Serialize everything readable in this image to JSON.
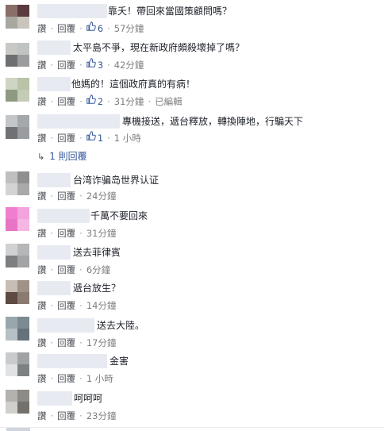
{
  "labels": {
    "like": "讚",
    "reply": "回覆",
    "dot": "·",
    "edited": "已編輯"
  },
  "comments": [
    {
      "text": "靠夭！帶回來當國策顧問嗎？",
      "likes": "6",
      "time": "57分鐘",
      "avatar": [
        "#8a6e6a",
        "#5c3b3f",
        "#a8a8a0",
        "#c9c4bc"
      ]
    },
    {
      "text": "太平島不爭，現在新政府頗殺壞掉了嗎？",
      "likes": "3",
      "time": "42分鐘",
      "avatar": [
        "#c8c8c4",
        "#bfc3c1",
        "#6d6f70",
        "#9a9c9d"
      ]
    },
    {
      "text": "他媽的！這個政府真的有病！",
      "likes": "2",
      "time": "31分鐘",
      "edited": true,
      "avatar": [
        "#cfd5c3",
        "#b8c3a8",
        "#8f9a82",
        "#c4ccb6"
      ]
    },
    {
      "text": "專機接送，遞台釋放，轉換陣地，行騙天下",
      "likes": "1",
      "time": "1 小時",
      "avatar": [
        "#c4c7c9",
        "#a4a8ab",
        "#6f7174",
        "#9a9da0"
      ]
    },
    {
      "text": "台湾诈骗岛世界认证",
      "time": "24分鐘",
      "avatar": [
        "#bfbfbf",
        "#8f8f8f",
        "#d3d3d3",
        "#a9a9a9"
      ]
    },
    {
      "text": "千萬不要回來",
      "time": "31分鐘",
      "avatar": [
        "#f07ed0",
        "#f3a3dd",
        "#e874c4",
        "#f6b6e3"
      ]
    },
    {
      "text": "送去菲律賓",
      "time": "6分鐘",
      "avatar": [
        "#cfd1d2",
        "#b5b7b8",
        "#7c7e80",
        "#a2a4a6"
      ]
    },
    {
      "text": "遞台放生？",
      "time": "14分鐘",
      "avatar": [
        "#c8bdb5",
        "#a09287",
        "#5e4a42",
        "#8a7b70"
      ]
    },
    {
      "text": "送去大陸。",
      "time": "17分鐘",
      "avatar": [
        "#9aa6ad",
        "#7b8a93",
        "#b7c0c5",
        "#65727a"
      ]
    },
    {
      "text": "金害",
      "time": "1 小時",
      "avatar": [
        "#c9cbcd",
        "#9fa3a6",
        "#e0e2e3",
        "#7d8184"
      ]
    },
    {
      "text": "呵呵呵",
      "time": "23分鐘",
      "avatar": [
        "#b4b2ae",
        "#8e8a85",
        "#d1cfcb",
        "#74716c"
      ]
    }
  ],
  "replies_link": {
    "label": "1 則回覆"
  }
}
